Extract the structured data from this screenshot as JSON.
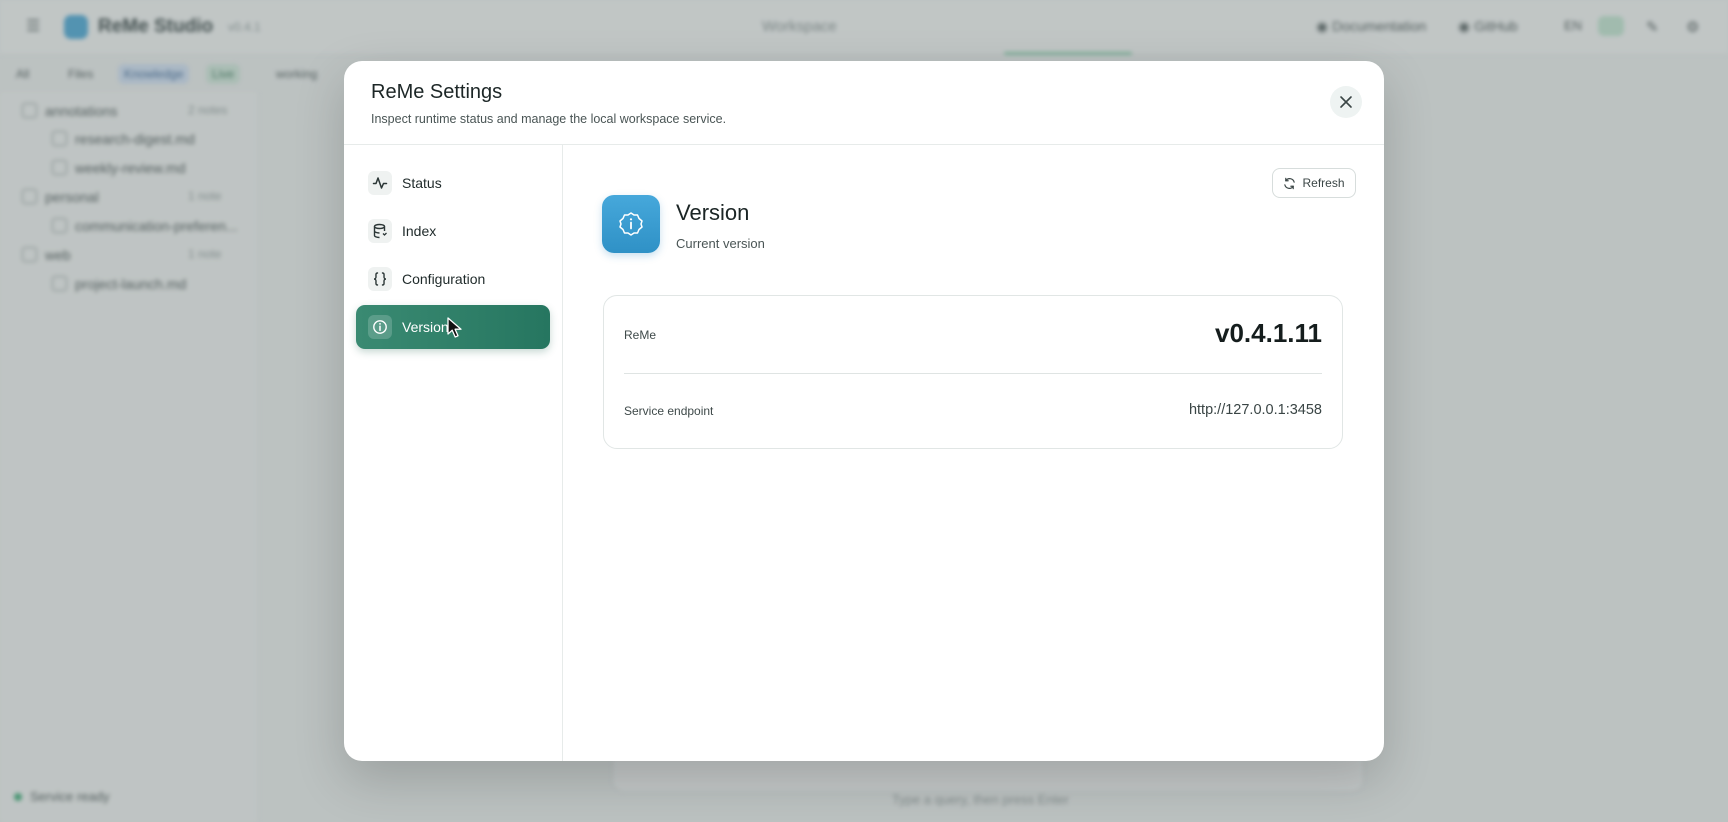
{
  "background_app": {
    "app_name": "ReMe Studio",
    "version_chip": "v0.4.1",
    "center_title": "Workspace",
    "documentation_label": "Documentation",
    "github_label": "GitHub",
    "lang_label": "EN",
    "toolbar": {
      "all_label": "All",
      "files_label": "Files",
      "knowledge_label": "Knowledge",
      "tab_label": "Live",
      "breadcrumb": "working"
    },
    "tree": [
      {
        "label": "annotations",
        "count": "2 notes",
        "indent": 0
      },
      {
        "label": "research-digest.md",
        "count": "",
        "indent": 1
      },
      {
        "label": "weekly-review.md",
        "count": "",
        "indent": 1
      },
      {
        "label": "personal",
        "count": "1 note",
        "indent": 0
      },
      {
        "label": "communication-preferen...",
        "count": "",
        "indent": 1
      },
      {
        "label": "web",
        "count": "1 note",
        "indent": 0
      },
      {
        "label": "project-launch.md",
        "count": "",
        "indent": 1
      }
    ],
    "footer_status": "Service ready",
    "bottom_hint": "Type a query, then press Enter"
  },
  "modal": {
    "title": "ReMe Settings",
    "subtitle": "Inspect runtime status and manage the local workspace service.",
    "close_icon": "close-icon",
    "nav": [
      {
        "label": "Status",
        "icon": "activity-icon",
        "active": false
      },
      {
        "label": "Index",
        "icon": "database-icon",
        "active": false
      },
      {
        "label": "Configuration",
        "icon": "braces-icon",
        "active": false
      },
      {
        "label": "Version",
        "icon": "info-icon",
        "active": true
      }
    ],
    "content": {
      "refresh_label": "Refresh",
      "section_title": "Version",
      "section_subtitle": "Current version",
      "rows": [
        {
          "key": "ReMe",
          "value": "v0.4.1.11"
        },
        {
          "key": "Service endpoint",
          "value": "http://127.0.0.1:3458"
        }
      ]
    }
  },
  "colors": {
    "accent_green": "#2f7f68",
    "badge_blue": "#3aa0d4"
  }
}
